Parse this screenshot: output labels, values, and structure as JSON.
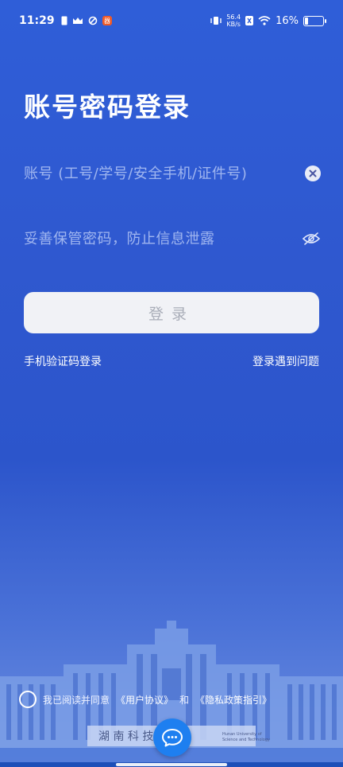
{
  "status_bar": {
    "time": "11:29",
    "net_speed_value": "56.4",
    "net_speed_unit": "KB/s",
    "battery": "16%"
  },
  "page": {
    "title": "账号密码登录"
  },
  "form": {
    "account_placeholder": "账号 (工号/学号/安全手机/证件号)",
    "password_placeholder": "妥善保管密码，防止信息泄露",
    "login_label": "登录"
  },
  "links": {
    "sms_login": "手机验证码登录",
    "login_problem": "登录遇到问题"
  },
  "agreement": {
    "prefix": "我已阅读并同意",
    "user_agreement": "《用户协议》",
    "and": "和",
    "privacy_policy": "《隐私政策指引》"
  },
  "campus_caption": {
    "en_line1": "Hunan University of",
    "en_line2": "Science and Technology"
  },
  "colors": {
    "background": "#2f58cf",
    "button_bg": "#f1f2f6",
    "button_text": "#a9adb8",
    "fab": "#1e7ff0"
  },
  "icons": [
    "signal-icon",
    "crown-icon",
    "app-icon",
    "vibrate-icon",
    "wifi-icon",
    "battery-icon",
    "clear-icon",
    "eye-off-icon",
    "chat-icon"
  ]
}
